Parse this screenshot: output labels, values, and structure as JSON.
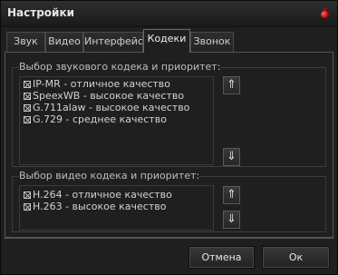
{
  "window": {
    "title": "Настройки"
  },
  "tabs": [
    "Звук",
    "Видео",
    "Интерфейс",
    "Кодеки",
    "Звонок"
  ],
  "audio": {
    "label": "Выбор звукового кодека и приоритет:",
    "codecs": [
      "IP-MR - отличное качество",
      "SpeexWB - высокое качество",
      "G.711alaw - высокое качество",
      "G.729 - среднее качество"
    ]
  },
  "video": {
    "label": "Выбор видео кодека и приоритет:",
    "codecs": [
      "H.264 - отличное качество",
      "H.263 - высокое качество"
    ]
  },
  "arrows": {
    "up": "⇑",
    "down": "⇓"
  },
  "buttons": {
    "cancel": "Отмена",
    "ok": "Ок"
  }
}
